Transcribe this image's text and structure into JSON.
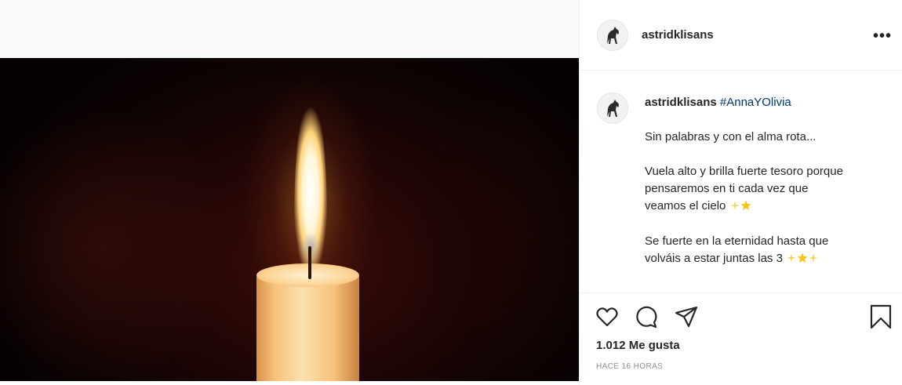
{
  "post": {
    "author": "astridklisans",
    "hashtag": "#AnnaYOlivia",
    "caption_lines": [
      "Sin palabras y con el alma rota...",
      "Vuela alto y brilla fuerte tesoro porque",
      "pensaremos en ti cada vez que",
      "veamos el cielo",
      "Se fuerte en la eternidad hasta que",
      "volváis a estar juntas las 3"
    ],
    "likes": "1.012 Me gusta",
    "timestamp": "HACE 16 HORAS"
  },
  "icons": {
    "more": "more-options-icon",
    "like": "heart-icon",
    "comment": "comment-icon",
    "share": "paper-plane-icon",
    "save": "bookmark-icon",
    "sparkle": "sparkles-emoji",
    "star": "glowing-star-emoji"
  },
  "colors": {
    "hashtag": "#00376b",
    "text": "#262626",
    "muted": "#8e8e8e",
    "sparkle": "#f5d247"
  }
}
